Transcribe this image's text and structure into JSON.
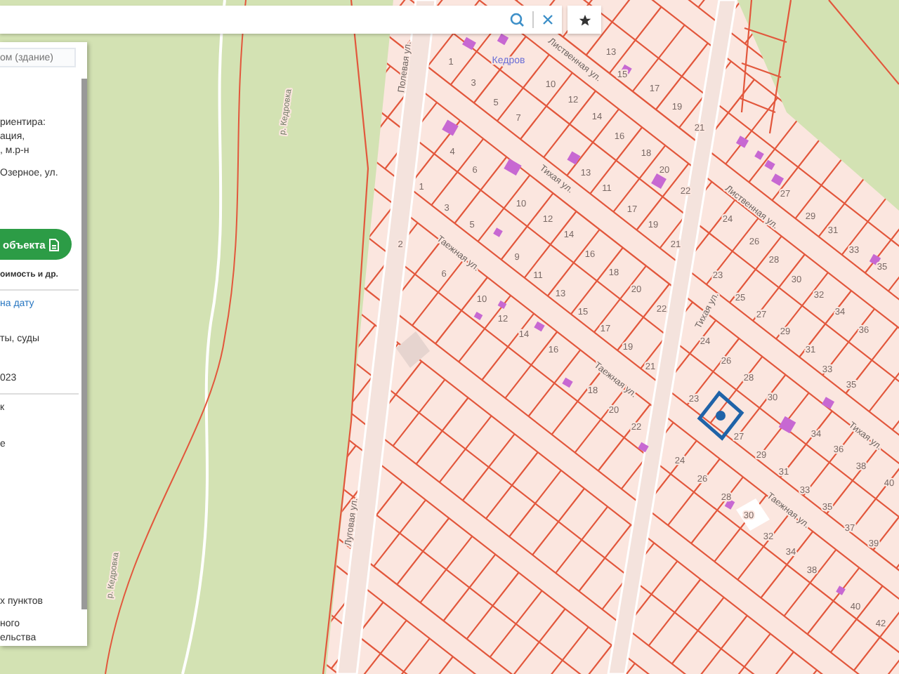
{
  "search": {
    "search_icon": true
  },
  "panel": {
    "search_placeholder": "ом (здание)",
    "address_lines": [
      "риентира:",
      "ация,",
      ", м.р-н"
    ],
    "street_line": "Озерное, ул.",
    "order_button": "объекта",
    "order_note": "оимость и др.",
    "date_link": "на дату",
    "lines_a": [
      "ты, суды",
      "023"
    ],
    "lines_b": [
      "к",
      "е"
    ],
    "lines_c": [
      "х пунктов",
      "ного",
      "ельства"
    ]
  },
  "map": {
    "place_label": "Кедров",
    "river_labels": [
      "р. Кедровка",
      "р. Кедровка"
    ],
    "street_labels": [
      "Полевая ул.",
      "Лиственная ул.",
      "Тихая ул.",
      "Таежная ул.",
      "Лиственная ул.",
      "Тихая ул.",
      "Таежная ул.",
      "Тихая ул.",
      "Таежная ул.",
      "Луговая ул."
    ],
    "parcel_numbers": [
      "13",
      "15",
      "17",
      "19",
      "21",
      "1",
      "3",
      "5",
      "7",
      "10",
      "12",
      "14",
      "16",
      "18",
      "20",
      "22",
      "4",
      "6",
      "13",
      "10",
      "11",
      "12",
      "14",
      "17",
      "19",
      "21",
      "16",
      "18",
      "20",
      "22",
      "1",
      "3",
      "5",
      "9",
      "11",
      "13",
      "15",
      "17",
      "2",
      "6",
      "10",
      "12",
      "24",
      "26",
      "28",
      "30",
      "32",
      "34",
      "36",
      "23",
      "25",
      "27",
      "27",
      "29",
      "29",
      "31",
      "33",
      "35",
      "14",
      "16",
      "19",
      "21",
      "18",
      "20",
      "22",
      "24",
      "26",
      "28",
      "30",
      "23",
      "27",
      "29",
      "31",
      "33",
      "35",
      "37",
      "39",
      "24",
      "26",
      "28",
      "30",
      "32",
      "34",
      "38",
      "40",
      "42",
      "31",
      "33",
      "35",
      "34",
      "36",
      "38",
      "40"
    ],
    "selected_parcel": true
  }
}
